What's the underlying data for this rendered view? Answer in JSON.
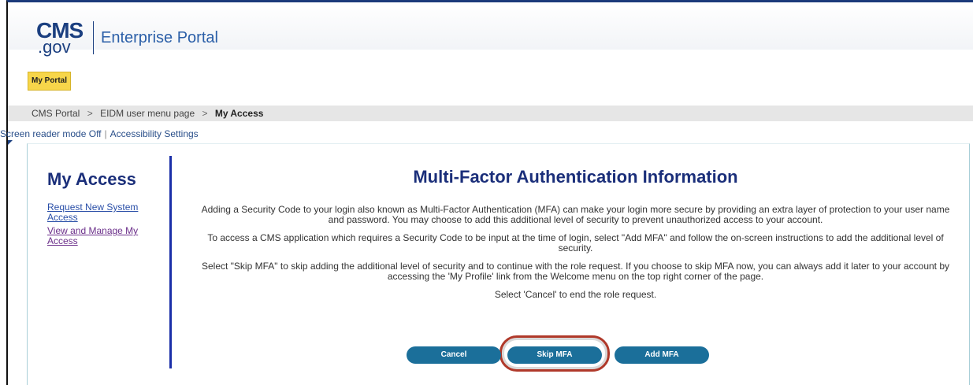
{
  "header": {
    "logo_cms": "CMS",
    "logo_gov": ".gov",
    "portal_title": "Enterprise Portal"
  },
  "nav": {
    "my_portal_tab": "My Portal"
  },
  "breadcrumb": {
    "items": [
      "CMS Portal",
      "EIDM user menu page",
      "My Access"
    ],
    "separator": ">"
  },
  "accessibility": {
    "screen_reader": "Screen reader mode Off",
    "settings": "Accessibility Settings"
  },
  "sidebar": {
    "title": "My Access",
    "links": [
      "Request New System Access",
      "View and Manage My Access"
    ]
  },
  "main": {
    "title": "Multi-Factor Authentication Information",
    "paragraphs": [
      "Adding a Security Code to your login also known as Multi-Factor Authentication (MFA) can make your login more secure by providing an extra layer of protection to your user name and password. You may choose to add this additional level of security to prevent unauthorized access to your account.",
      "To access a CMS application which requires a Security Code to be input at the time of login, select \"Add MFA\" and follow the on-screen instructions to add the additional level of security.",
      "Select \"Skip MFA\" to skip adding the additional level of security and to continue with the role request. If you choose to skip MFA now, you can always add it later to your account by accessing the 'My Profile' link from the Welcome menu on the top right corner of the page.",
      "Select 'Cancel' to end the role request."
    ]
  },
  "buttons": {
    "cancel": "Cancel",
    "skip": "Skip MFA",
    "add": "Add MFA"
  },
  "colors": {
    "brand_blue": "#1b3f80",
    "button_teal": "#1b6f9a",
    "highlight_red": "#b0392a",
    "portal_tab_yellow": "#f7d64a"
  }
}
